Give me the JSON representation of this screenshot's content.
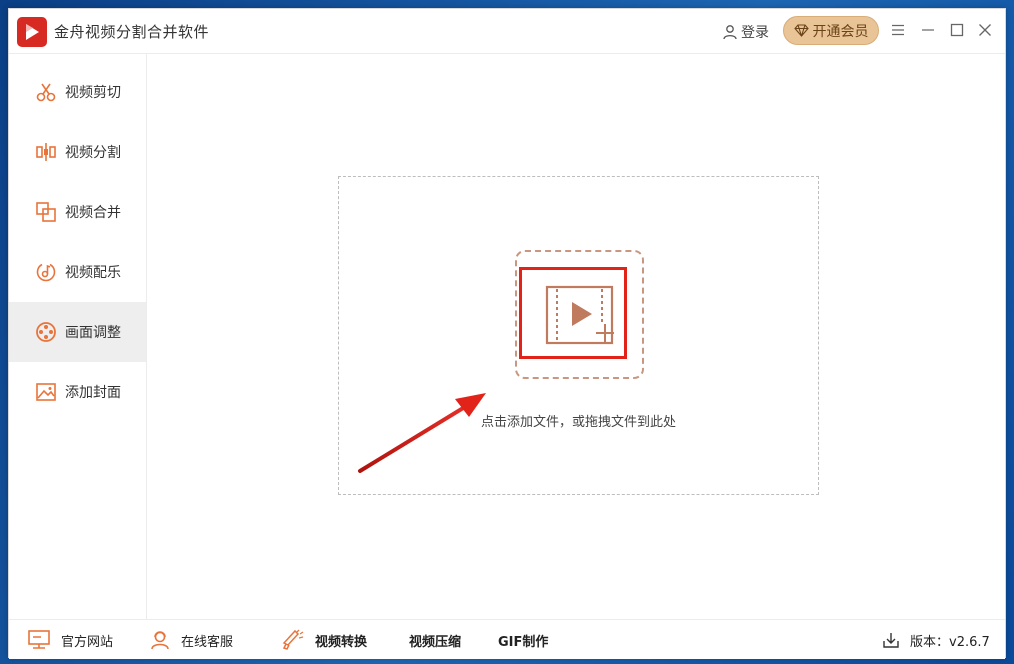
{
  "window": {
    "title": "金舟视频分割合并软件"
  },
  "header": {
    "login_label": "登录",
    "vip_label": "开通会员"
  },
  "sidebar": {
    "items": [
      {
        "label": "视频剪切",
        "icon": "scissors-icon"
      },
      {
        "label": "视频分割",
        "icon": "split-icon"
      },
      {
        "label": "视频合并",
        "icon": "merge-icon"
      },
      {
        "label": "视频配乐",
        "icon": "music-icon"
      },
      {
        "label": "画面调整",
        "icon": "film-reel-icon"
      },
      {
        "label": "添加封面",
        "icon": "image-icon"
      }
    ],
    "active_index": 4
  },
  "main": {
    "drop_hint": "点击添加文件，或拖拽文件到此处"
  },
  "bottom": {
    "website_label": "官方网站",
    "support_label": "在线客服",
    "convert_label": "视频转换",
    "compress_label": "视频压缩",
    "gif_label": "GIF制作",
    "version_label": "版本：v2.6.7"
  },
  "colors": {
    "accent": "#e8743b",
    "brand_red": "#d72a22",
    "vip_gold": "#e9c496",
    "highlight_red": "#e2231a"
  }
}
